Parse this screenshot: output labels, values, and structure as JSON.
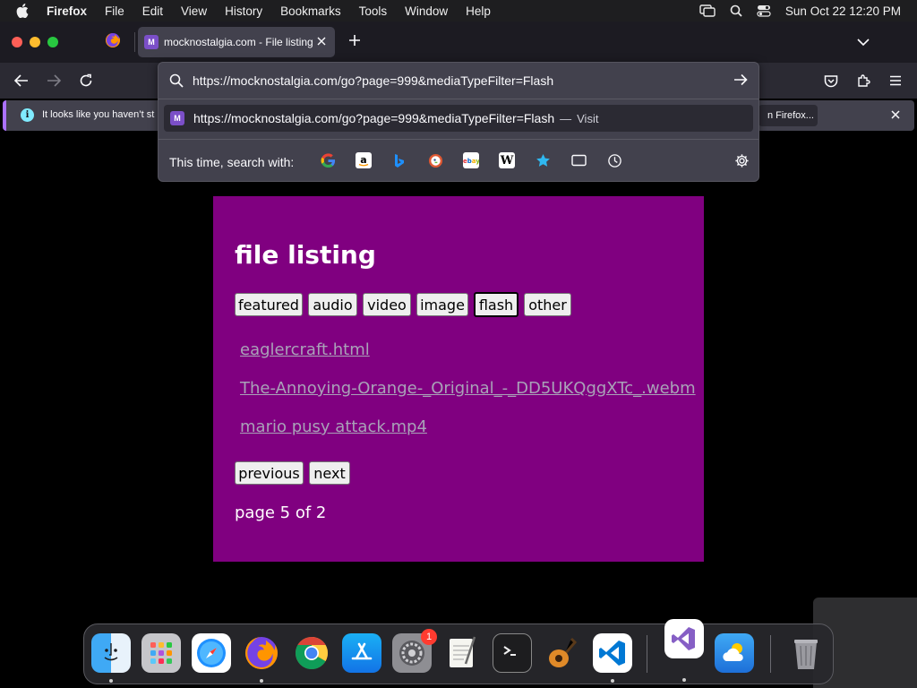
{
  "menubar": {
    "app_name": "Firefox",
    "items": [
      "File",
      "Edit",
      "View",
      "History",
      "Bookmarks",
      "Tools",
      "Window",
      "Help"
    ],
    "clock": "Sun Oct 22  12:20 PM"
  },
  "tabs": {
    "active_title": "mocknostalgia.com - File listing"
  },
  "notification": {
    "message": "It looks like you haven’t st",
    "button_tail": "n Firefox..."
  },
  "urlbar": {
    "url": "https://mocknostalgia.com/go?page=999&mediaTypeFilter=Flash",
    "suggestion_url": "https://mocknostalgia.com/go?page=999&mediaTypeFilter=Flash",
    "suggestion_dash": "—",
    "suggestion_action": "Visit",
    "search_with_label": "This time, search with:",
    "engines": [
      "google-icon",
      "amazon-icon",
      "bing-icon",
      "duckduckgo-icon",
      "ebay-icon",
      "wikipedia-icon",
      "bookmarks-star-icon",
      "tabs-icon",
      "history-icon"
    ],
    "settings_icon": "gear-icon"
  },
  "page": {
    "background": "#800080",
    "title": "file listing",
    "filters": [
      {
        "label": "featured",
        "active": false
      },
      {
        "label": "audio",
        "active": false
      },
      {
        "label": "video",
        "active": false
      },
      {
        "label": "image",
        "active": false
      },
      {
        "label": "flash",
        "active": true
      },
      {
        "label": "other",
        "active": false
      }
    ],
    "files": [
      "eaglercraft.html",
      "The-Annoying-Orange-_Original_-_DD5UKQggXTc_.webm",
      "mario pusy attack.mp4"
    ],
    "pager": {
      "previous": "previous",
      "next": "next"
    },
    "page_indicator": "page 5 of 2"
  },
  "dock": {
    "apps": [
      "finder-icon",
      "launchpad-icon",
      "safari-icon",
      "firefox-icon",
      "chrome-icon",
      "app-store-icon",
      "system-settings-icon",
      "textedit-icon",
      "terminal-icon",
      "garageband-icon",
      "vscode-icon",
      "visual-studio-icon",
      "weather-icon",
      "trash-icon"
    ],
    "system_settings_badge": "1"
  }
}
